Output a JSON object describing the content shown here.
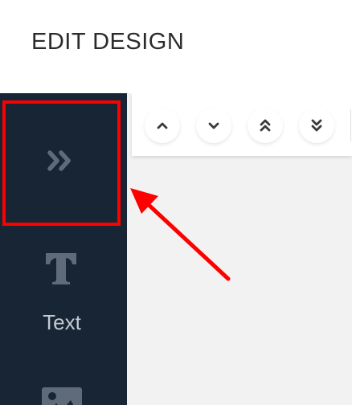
{
  "header": {
    "title": "EDIT DESIGN"
  },
  "sidebar": {
    "items": [
      {
        "name": "expand",
        "icon": "double-chevron-right-icon",
        "label": ""
      },
      {
        "name": "text",
        "icon": "text-t-icon",
        "label": "Text"
      },
      {
        "name": "image",
        "icon": "image-icon",
        "label": ""
      }
    ]
  },
  "toolbar": {
    "buttons": [
      {
        "icon": "chevron-up-icon"
      },
      {
        "icon": "chevron-down-icon"
      },
      {
        "icon": "double-chevron-up-icon"
      },
      {
        "icon": "double-chevron-down-icon"
      }
    ]
  },
  "colors": {
    "sidebar_bg": "#172534",
    "icon_color": "#5f6b78",
    "highlight": "#ff0000",
    "canvas_bg": "#f2f2f2"
  }
}
